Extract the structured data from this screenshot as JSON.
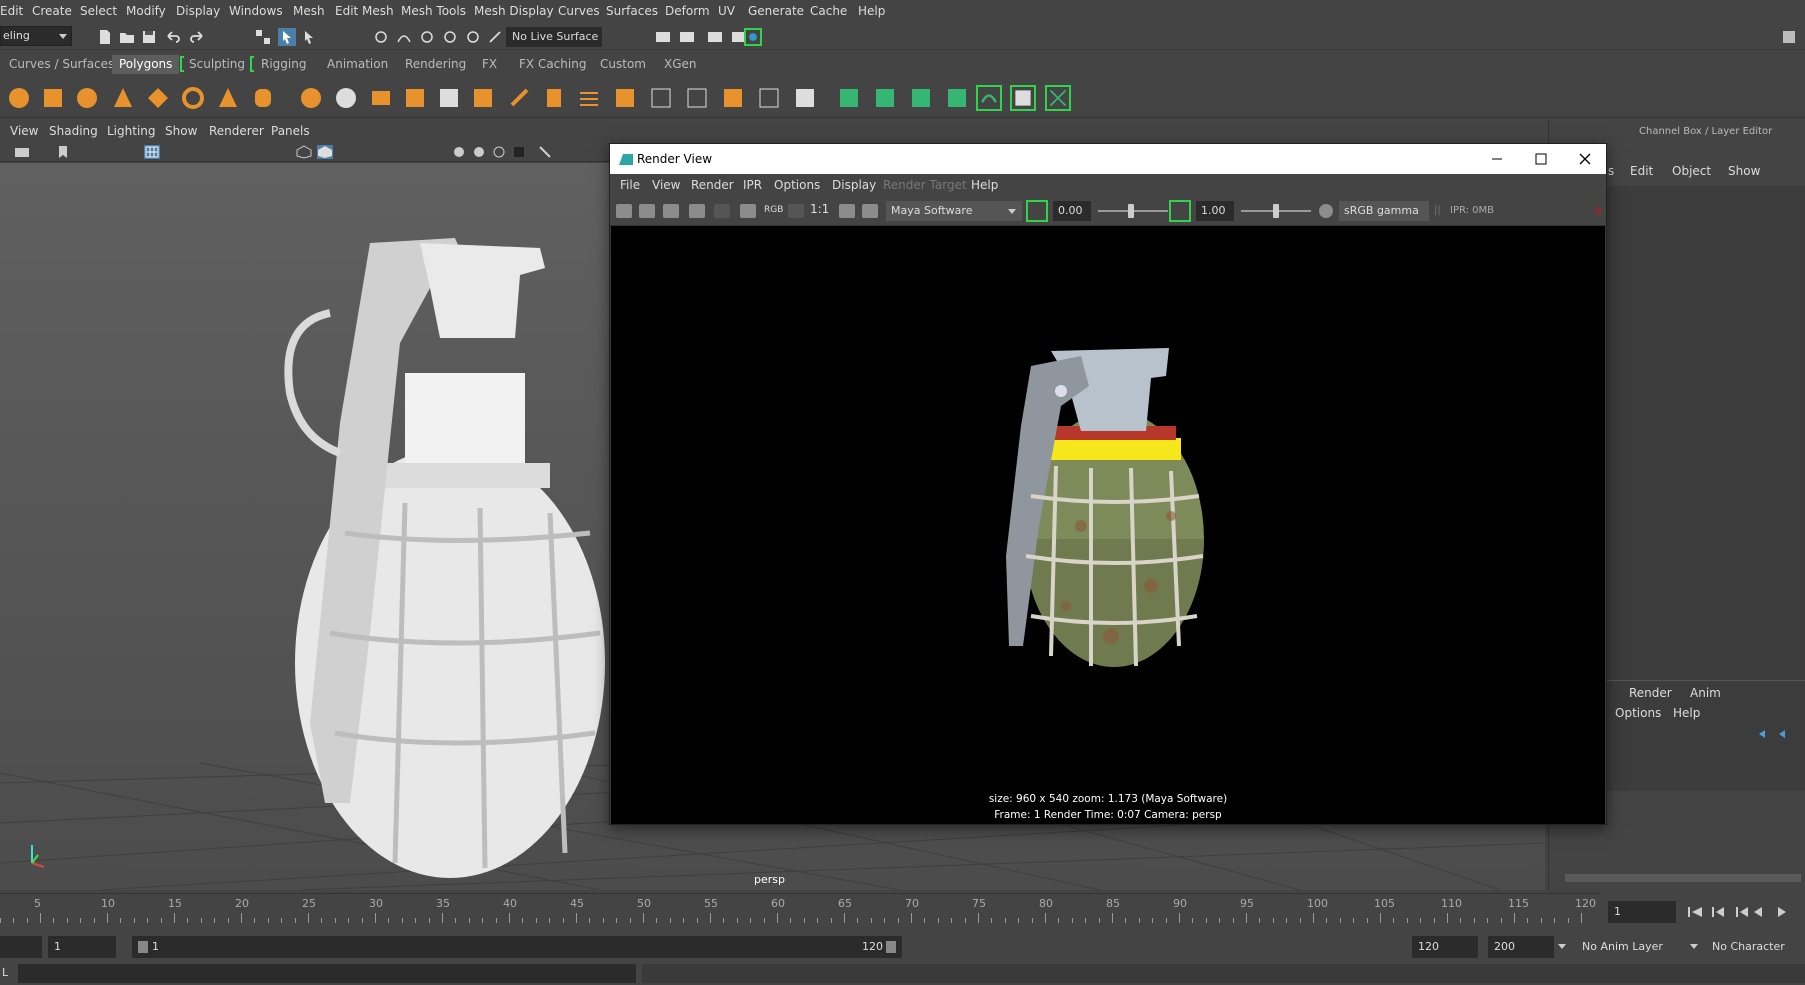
{
  "menubar": {
    "items": [
      "Edit",
      "Create",
      "Select",
      "Modify",
      "Display",
      "Windows",
      "Mesh",
      "Edit Mesh",
      "Mesh Tools",
      "Mesh Display",
      "Curves",
      "Surfaces",
      "Deform",
      "UV",
      "Generate",
      "Cache",
      "Help"
    ]
  },
  "statusline": {
    "mode": "eling",
    "live_surface": "No Live Surface"
  },
  "shelf": {
    "tabs": [
      "Curves / Surfaces",
      "Polygons",
      "Sculpting",
      "Rigging",
      "Animation",
      "Rendering",
      "FX",
      "FX Caching",
      "Custom",
      "XGen"
    ],
    "active_tab": "Polygons"
  },
  "viewport": {
    "menu": [
      "View",
      "Shading",
      "Lighting",
      "Show",
      "Renderer",
      "Panels"
    ],
    "camera_label": "persp"
  },
  "right_panel": {
    "title": "Channel Box / Layer Editor",
    "menu": [
      "s",
      "Edit",
      "Object",
      "Show"
    ],
    "layer_tabs": [
      "Render",
      "Anim"
    ],
    "layer_menu": [
      "Options",
      "Help"
    ]
  },
  "render_view": {
    "title": "Render View",
    "menu": [
      "File",
      "View",
      "Render",
      "IPR",
      "Options",
      "Display",
      "Render Target",
      "Help"
    ],
    "rgb_label": "RGB",
    "ratio_label": "1:1",
    "renderer": "Maya Software",
    "exposure": "0.00",
    "gamma": "1.00",
    "color_space": "sRGB gamma",
    "ipr_status": "IPR: 0MB",
    "info_line1": "size: 960 x 540  zoom: 1.173        (Maya Software)",
    "info_line2": "Frame: 1      Render Time: 0:07      Camera: persp"
  },
  "timeline": {
    "ticks": [
      "5",
      "10",
      "15",
      "20",
      "25",
      "30",
      "35",
      "40",
      "45",
      "50",
      "55",
      "60",
      "65",
      "70",
      "75",
      "80",
      "85",
      "90",
      "95",
      "100",
      "105",
      "110",
      "115",
      "120"
    ],
    "current_frame": "1"
  },
  "range": {
    "start": "1",
    "inner_start": "1",
    "inner_end": "120",
    "end": "120",
    "max": "200",
    "anim_layer": "No Anim Layer",
    "character_set": "No Character Set"
  },
  "cmdline": {
    "label": "L"
  },
  "colors": {
    "accent_green": "#2fd44a",
    "active_tab": "#5d5d5d",
    "grenade_body": "#7d8a5a",
    "grenade_band": "#f5e71c"
  }
}
